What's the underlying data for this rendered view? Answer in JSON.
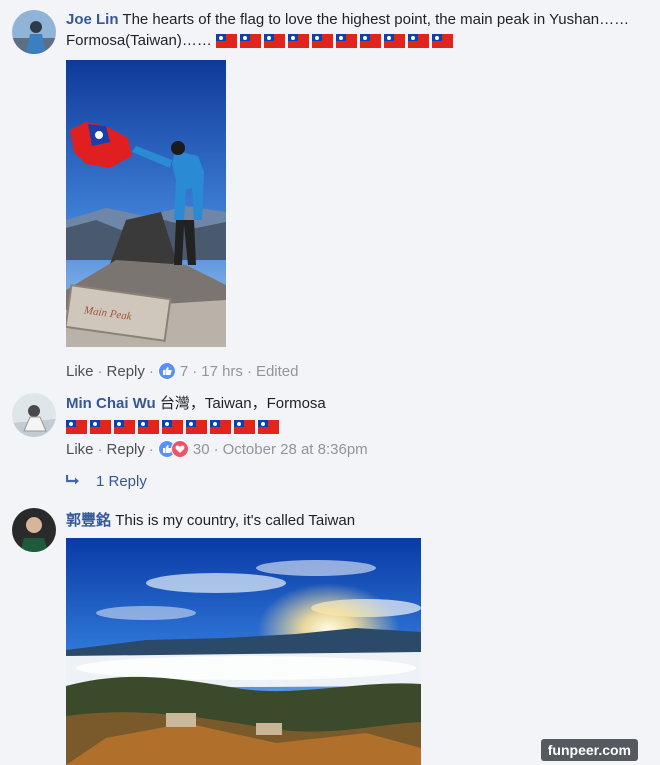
{
  "comments": [
    {
      "author": "Joe Lin",
      "text": "The hearts of the flag to love the highest point, the main peak in Yushan……Formosa(Taiwan)……",
      "flag_count": 10,
      "photo_sign_text": "Main Peak",
      "actions": {
        "like": "Like",
        "reply": "Reply",
        "reaction_count": "7",
        "time": "17 hrs",
        "edited": "Edited"
      }
    },
    {
      "author": "Min Chai Wu",
      "text": "台灣，Taiwan，Formosa",
      "flag_count": 9,
      "actions": {
        "like": "Like",
        "reply": "Reply",
        "reaction_count": "30",
        "time": "October 28 at 8:36pm"
      },
      "replies_label": "1 Reply"
    },
    {
      "author": "郭豐銘",
      "text": "This is my country, it's called Taiwan"
    }
  ],
  "watermark": "funpeer.com",
  "icons": {
    "like_reaction": "thumbs-up-icon",
    "love_reaction": "heart-icon",
    "reply_arrow": "reply-arrow-icon",
    "flag": "taiwan-flag-icon"
  },
  "colors": {
    "author": "#365899",
    "like": "#5890ff",
    "love": "#f25268",
    "background": "#f2f4f8"
  }
}
